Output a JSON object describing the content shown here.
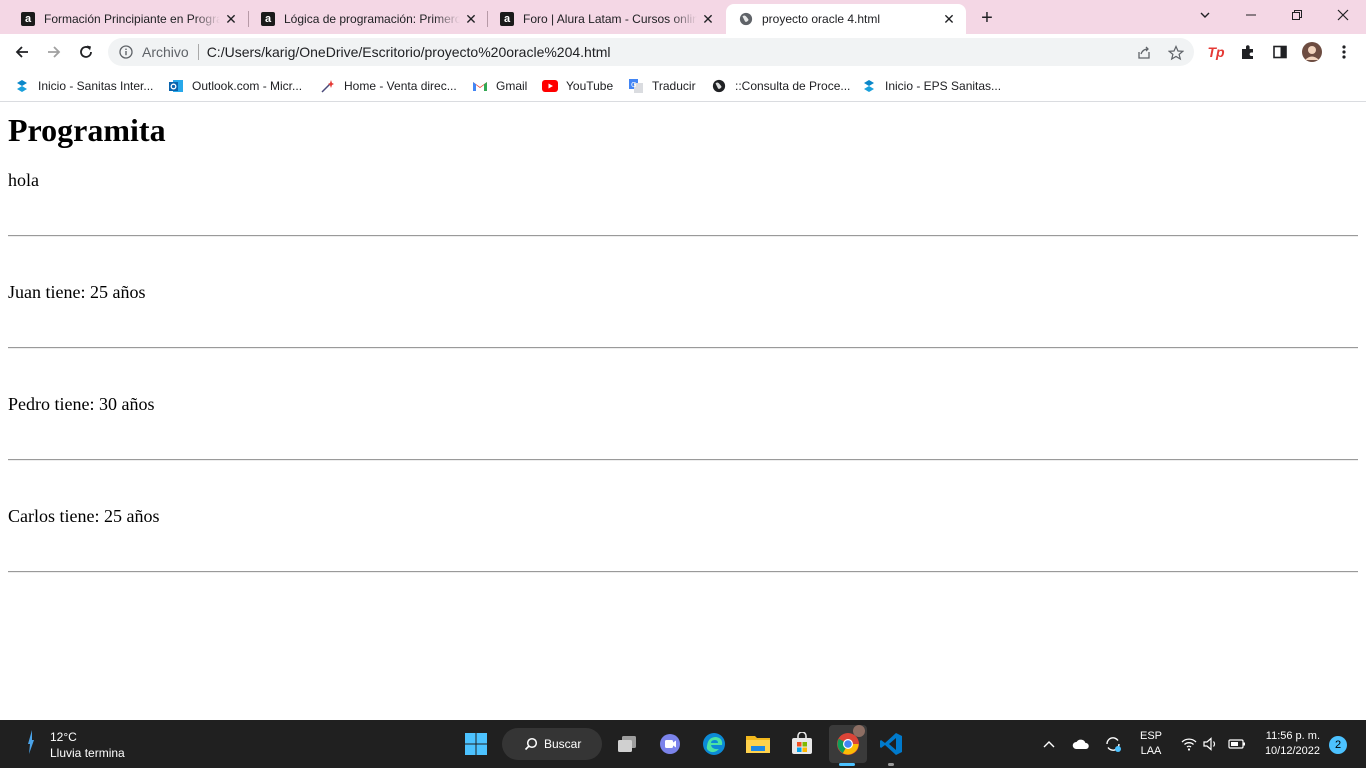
{
  "tabs": [
    {
      "title": "Formación Principiante en Progra",
      "icon": "alura-icon",
      "active": false
    },
    {
      "title": "Lógica de programación: Primero",
      "icon": "alura-icon",
      "active": false
    },
    {
      "title": "Foro | Alura Latam - Cursos onlin",
      "icon": "alura-icon",
      "active": false
    },
    {
      "title": "proyecto oracle 4.html",
      "icon": "globe-icon",
      "active": true
    }
  ],
  "address_bar": {
    "origin_label": "Archivo",
    "url": "C:/Users/karig/OneDrive/Escritorio/proyecto%20oracle%204.html"
  },
  "bookmarks": [
    {
      "label": "Inicio - Sanitas Inter...",
      "icon": "sanitas-icon"
    },
    {
      "label": "Outlook.com - Micr...",
      "icon": "outlook-icon"
    },
    {
      "label": "Home - Venta direc...",
      "icon": "sparkle-icon"
    },
    {
      "label": "Gmail",
      "icon": "gmail-icon"
    },
    {
      "label": "YouTube",
      "icon": "youtube-icon"
    },
    {
      "label": "Traducir",
      "icon": "translate-icon"
    },
    {
      "label": "::Consulta de Proce...",
      "icon": "globe-icon"
    },
    {
      "label": "Inicio - EPS Sanitas...",
      "icon": "sanitas-icon"
    }
  ],
  "page": {
    "heading": "Programita",
    "greeting": "hola",
    "entries": [
      "Juan tiene: 25 años",
      "Pedro tiene: 30 años",
      "Carlos tiene: 25 años"
    ]
  },
  "taskbar": {
    "weather": {
      "temperature": "12°C",
      "condition": "Lluvia termina"
    },
    "search_label": "Buscar",
    "language": {
      "line1": "ESP",
      "line2": "LAA"
    },
    "clock": {
      "time": "11:56 p. m.",
      "date": "10/12/2022"
    },
    "notification_count": "2"
  },
  "colors": {
    "tab_strip": "#f4d7e5",
    "taskbar": "#202020",
    "accent": "#4cc2ff"
  }
}
